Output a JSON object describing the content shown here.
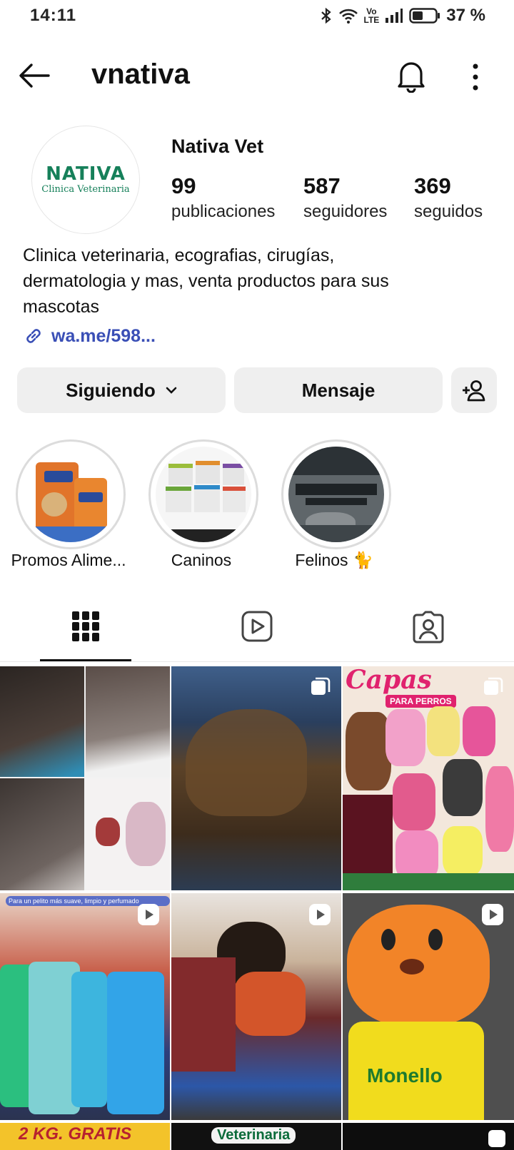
{
  "status_bar": {
    "time": "14:11",
    "battery": "37 %"
  },
  "header": {
    "username": "vnativa"
  },
  "profile": {
    "avatar_brand": "NATIVA",
    "avatar_subtitle": "Clinica Veterinaria",
    "display_name": "Nativa Vet",
    "stats": [
      {
        "value": "99",
        "label": "publicaciones"
      },
      {
        "value": "587",
        "label": "seguidores"
      },
      {
        "value": "369",
        "label": "seguidos"
      }
    ],
    "bio_line1": "Clinica veterinaria, ecografias, cirugías,",
    "bio_line2": "dermatologia y mas, venta productos para sus",
    "bio_line3": "mascotas",
    "link": "wa.me/598..."
  },
  "actions": {
    "following": "Siguiendo",
    "message": "Mensaje"
  },
  "highlights": [
    {
      "label": "Promos Alime..."
    },
    {
      "label": "Caninos"
    },
    {
      "label": "Felinos 🐈"
    }
  ],
  "posts": {
    "capas_title": "Capas",
    "capas_sub": "PARA PERROS",
    "monello_text": "Monello",
    "shampoo_banner": "Para un pelito más suave, limpio y perfumado",
    "bottom_banner": "2 KG. GRATIS",
    "bottom_banner2": "Veterinaria"
  },
  "colors": {
    "accent_link": "#3a4fb6",
    "brand_green": "#16805a"
  }
}
